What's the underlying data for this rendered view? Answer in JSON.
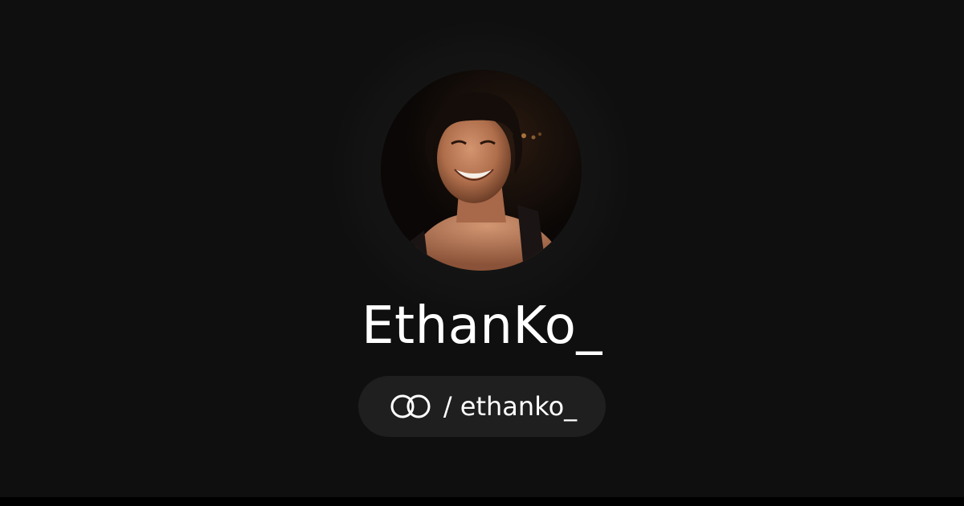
{
  "profile": {
    "display_name": "EthanKo_",
    "separator": "/",
    "handle": "ethanko_",
    "avatar_icon": "profile-photo",
    "platform_icon": "linked-rings-icon"
  },
  "colors": {
    "background": "#0f0f0f",
    "pill_background": "#1f1f1f",
    "text": "#ffffff"
  }
}
